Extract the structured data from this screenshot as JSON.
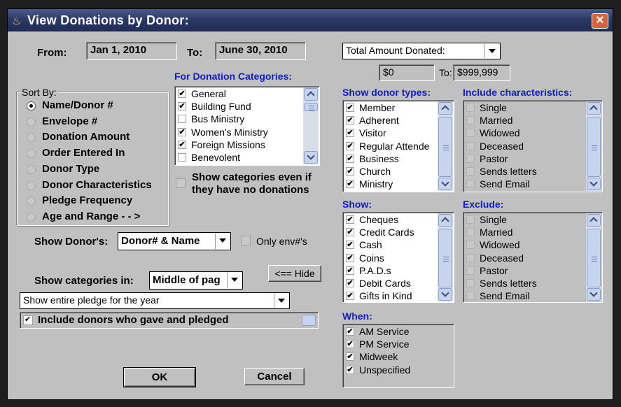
{
  "window": {
    "title": "View Donations by Donor:",
    "close_glyph": "✕"
  },
  "dates": {
    "from_label": "From:",
    "from_value": "Jan 1, 2010",
    "to_label": "To:",
    "to_value": "June 30, 2010"
  },
  "amount": {
    "selected": "Total Amount Donated:",
    "min": "$0",
    "to_label": "To:",
    "max": "$999,999"
  },
  "sort_by": {
    "label": "Sort By:",
    "options": [
      "Name/Donor #",
      "Envelope #",
      "Donation Amount",
      "Order Entered In",
      "Donor Type",
      "Donor Characteristics",
      "Pledge Frequency",
      "Age and Range - - >"
    ],
    "selected_index": 0
  },
  "donation_categories": {
    "label": "For Donation Categories:",
    "items": [
      {
        "label": "General",
        "checked": true
      },
      {
        "label": "Building Fund",
        "checked": true
      },
      {
        "label": "Bus Ministry",
        "checked": false
      },
      {
        "label": "Women's Ministry",
        "checked": true
      },
      {
        "label": "Foreign Missions",
        "checked": true
      },
      {
        "label": "Benevolent",
        "checked": false
      }
    ],
    "show_even_if_none": "Show categories even if they have no donations"
  },
  "donor_types": {
    "label": "Show donor types:",
    "items": [
      {
        "label": "Member",
        "checked": true
      },
      {
        "label": "Adherent",
        "checked": true
      },
      {
        "label": "Visitor",
        "checked": true
      },
      {
        "label": "Regular Attende",
        "checked": true
      },
      {
        "label": "Business",
        "checked": true
      },
      {
        "label": "Church",
        "checked": true
      },
      {
        "label": "Ministry",
        "checked": true
      }
    ]
  },
  "characteristics": {
    "label": "Include characteristics:",
    "items": [
      {
        "label": "Single",
        "checked": false
      },
      {
        "label": "Married",
        "checked": false
      },
      {
        "label": "Widowed",
        "checked": false
      },
      {
        "label": "Deceased",
        "checked": false
      },
      {
        "label": "Pastor",
        "checked": false
      },
      {
        "label": "Sends letters",
        "checked": false
      },
      {
        "label": "Send Email",
        "checked": false
      }
    ]
  },
  "show": {
    "label": "Show:",
    "items": [
      {
        "label": "Cheques",
        "checked": true
      },
      {
        "label": "Credit Cards",
        "checked": true
      },
      {
        "label": "Cash",
        "checked": true
      },
      {
        "label": "Coins",
        "checked": true
      },
      {
        "label": "P.A.D.s",
        "checked": true
      },
      {
        "label": "Debit Cards",
        "checked": true
      },
      {
        "label": "Gifts in Kind",
        "checked": true
      }
    ]
  },
  "exclude": {
    "label": "Exclude:",
    "items": [
      {
        "label": "Single",
        "checked": false
      },
      {
        "label": "Married",
        "checked": false
      },
      {
        "label": "Widowed",
        "checked": false
      },
      {
        "label": "Deceased",
        "checked": false
      },
      {
        "label": "Pastor",
        "checked": false
      },
      {
        "label": "Sends letters",
        "checked": false
      },
      {
        "label": "Send Email",
        "checked": false
      }
    ]
  },
  "when": {
    "label": "When:",
    "items": [
      {
        "label": "AM Service",
        "checked": true
      },
      {
        "label": "PM Service",
        "checked": true
      },
      {
        "label": "Midweek",
        "checked": true
      },
      {
        "label": "Unspecified",
        "checked": true
      }
    ]
  },
  "show_donors": {
    "label": "Show Donor's:",
    "selected": "Donor# & Name",
    "only_env_label": "Only env#'s"
  },
  "show_categories_in": {
    "label": "Show categories in:",
    "selected": "Middle of pag"
  },
  "hide_button": "<== Hide",
  "pledge_option": "Show entire pledge for the year",
  "include_donors": {
    "label": "Include donors who gave and pledged",
    "checked": true
  },
  "buttons": {
    "ok": "OK",
    "cancel": "Cancel"
  }
}
